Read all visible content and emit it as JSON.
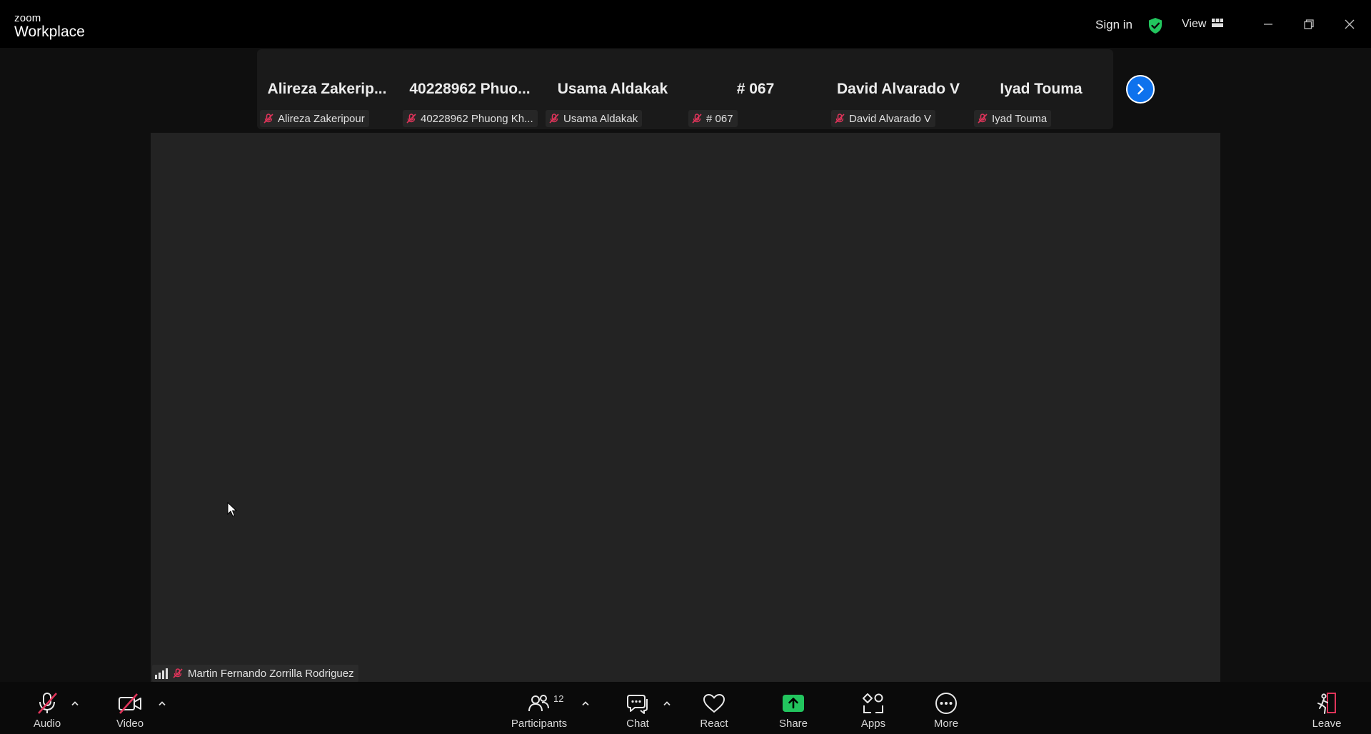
{
  "app": {
    "logo_small": "zoom",
    "logo_big": "Workplace",
    "sign_in": "Sign in",
    "view_label": "View",
    "colors": {
      "accent": "#0e72ed",
      "shield": "#22c55e",
      "share": "#22c55e",
      "muted": "#e0345a"
    }
  },
  "thumbnails": [
    {
      "display": "Alireza  Zakerip...",
      "name": "Alireza Zakeripour"
    },
    {
      "display": "40228962  Phuo...",
      "name": "40228962 Phuong Kh..."
    },
    {
      "display": "Usama Aldakak",
      "name": "Usama Aldakak"
    },
    {
      "display": "# 067",
      "name": "# 067"
    },
    {
      "display": "David Alvarado V",
      "name": "David Alvarado V"
    },
    {
      "display": "Iyad Touma",
      "name": "Iyad Touma"
    }
  ],
  "main": {
    "speaker_name": "Martin Fernando Zorrilla Rodriguez"
  },
  "toolbar": {
    "audio": "Audio",
    "video": "Video",
    "participants": "Participants",
    "participants_count": "12",
    "chat": "Chat",
    "react": "React",
    "share": "Share",
    "apps": "Apps",
    "more": "More",
    "leave": "Leave"
  }
}
